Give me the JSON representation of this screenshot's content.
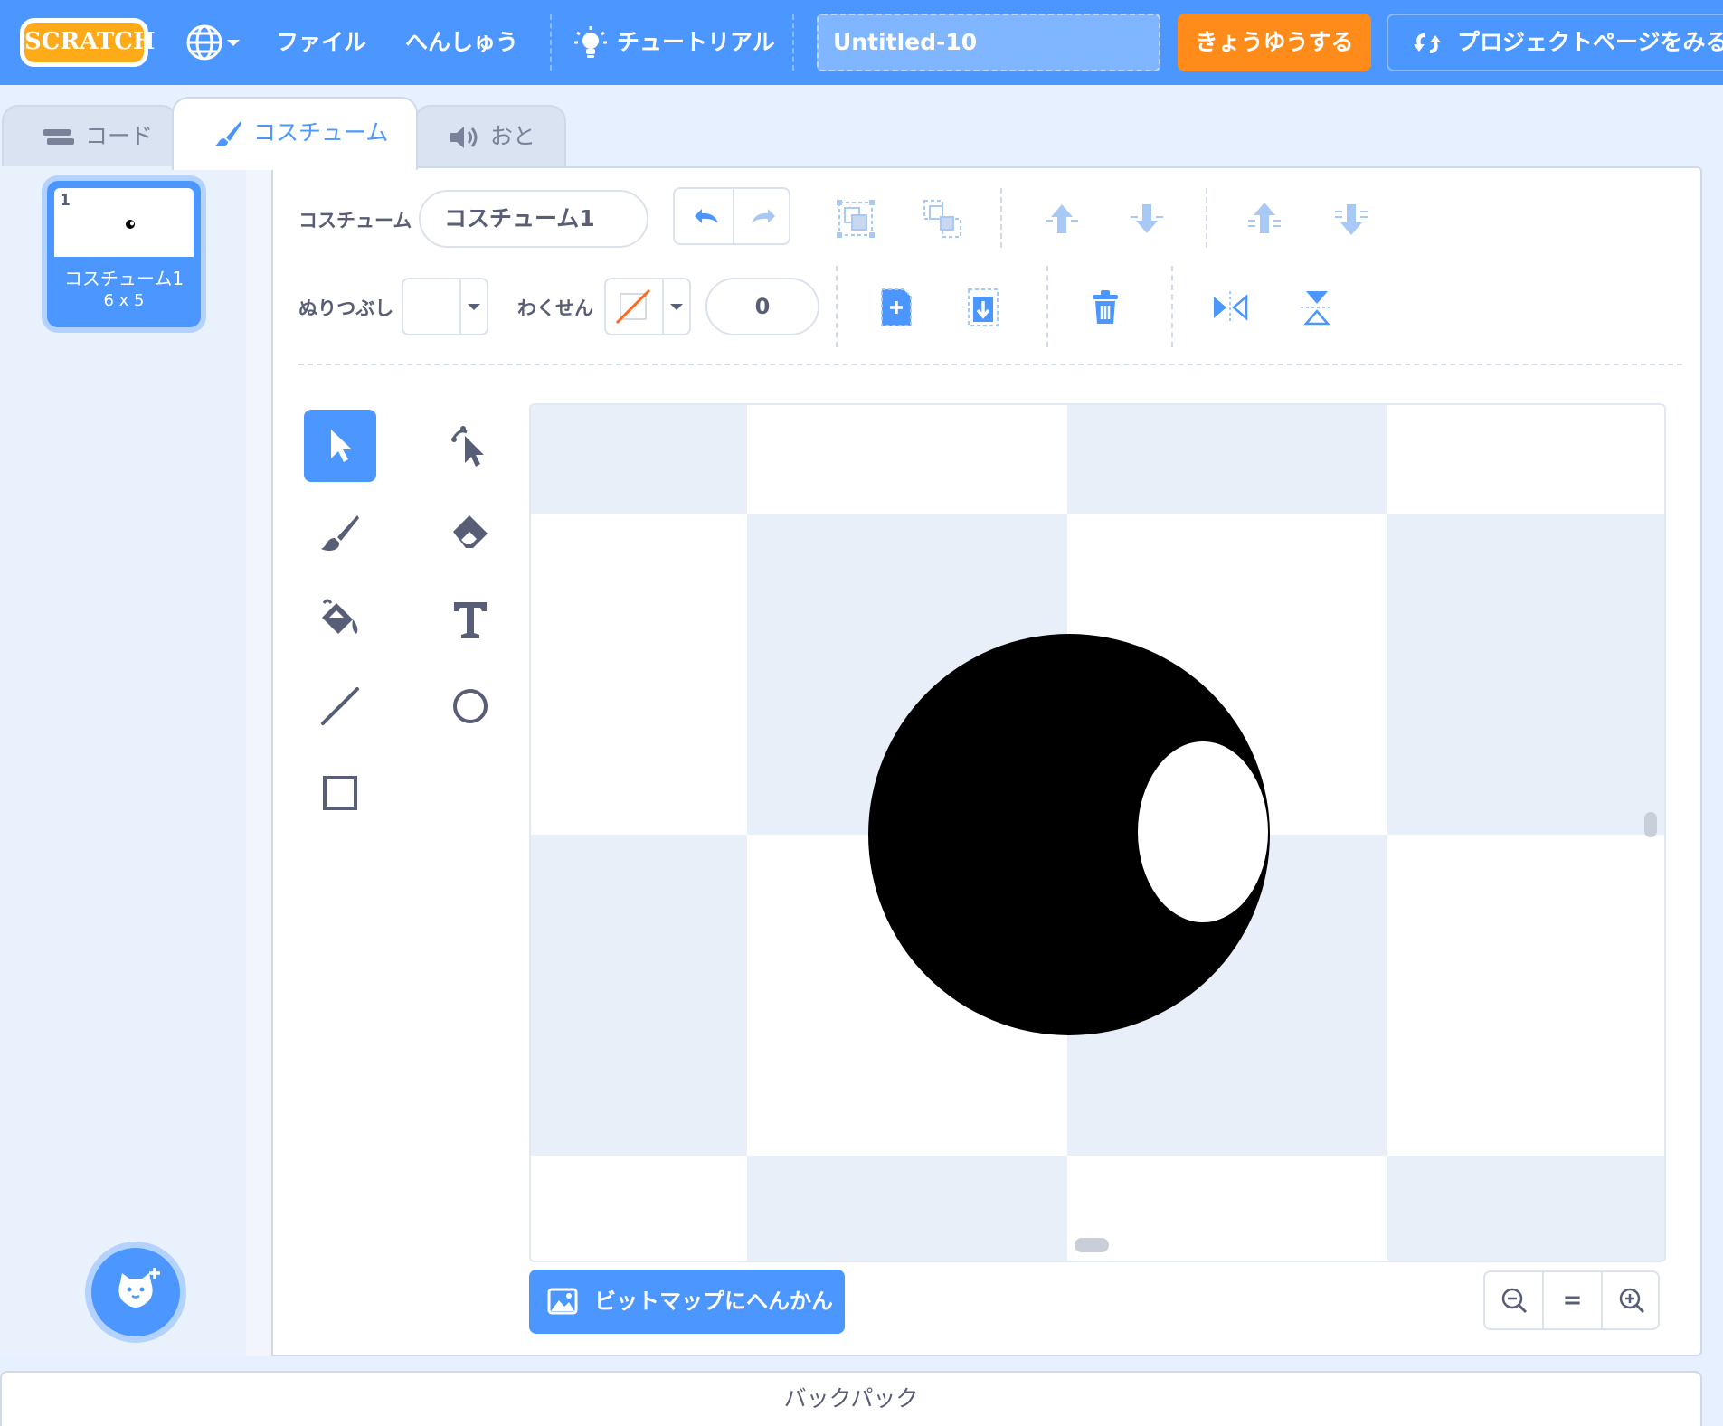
{
  "menubar": {
    "logo_text": "SCRATCH",
    "file": "ファイル",
    "edit": "へんしゅう",
    "tutorials": "チュートリアル",
    "project_title": "Untitled-10",
    "share": "きょうゆうする",
    "see_project_page": "プロジェクトページをみる"
  },
  "tabs": {
    "code": "コード",
    "costumes": "コスチューム",
    "sounds": "おと"
  },
  "costume_list": [
    {
      "number": "1",
      "name": "コスチューム1",
      "size": "6 x 5"
    }
  ],
  "editor": {
    "costume_label": "コスチューム",
    "costume_name": "コスチューム1",
    "fill_label": "ぬりつぶし",
    "outline_label": "わくせん",
    "outline_width": "0",
    "fill_color": "#ffffff",
    "outline_color": "none",
    "convert_button": "ビットマップにへんかん",
    "zoom_reset": "="
  },
  "tools": [
    "select",
    "reshape",
    "brush",
    "eraser",
    "fill",
    "text",
    "line",
    "circle",
    "rectangle"
  ],
  "selected_tool": "select",
  "backpack": {
    "label": "バックパック"
  },
  "colors": {
    "menubar": "#4c97ff",
    "share": "#ff8c1a",
    "accent": "#4c97ff",
    "text": "#575e75"
  }
}
